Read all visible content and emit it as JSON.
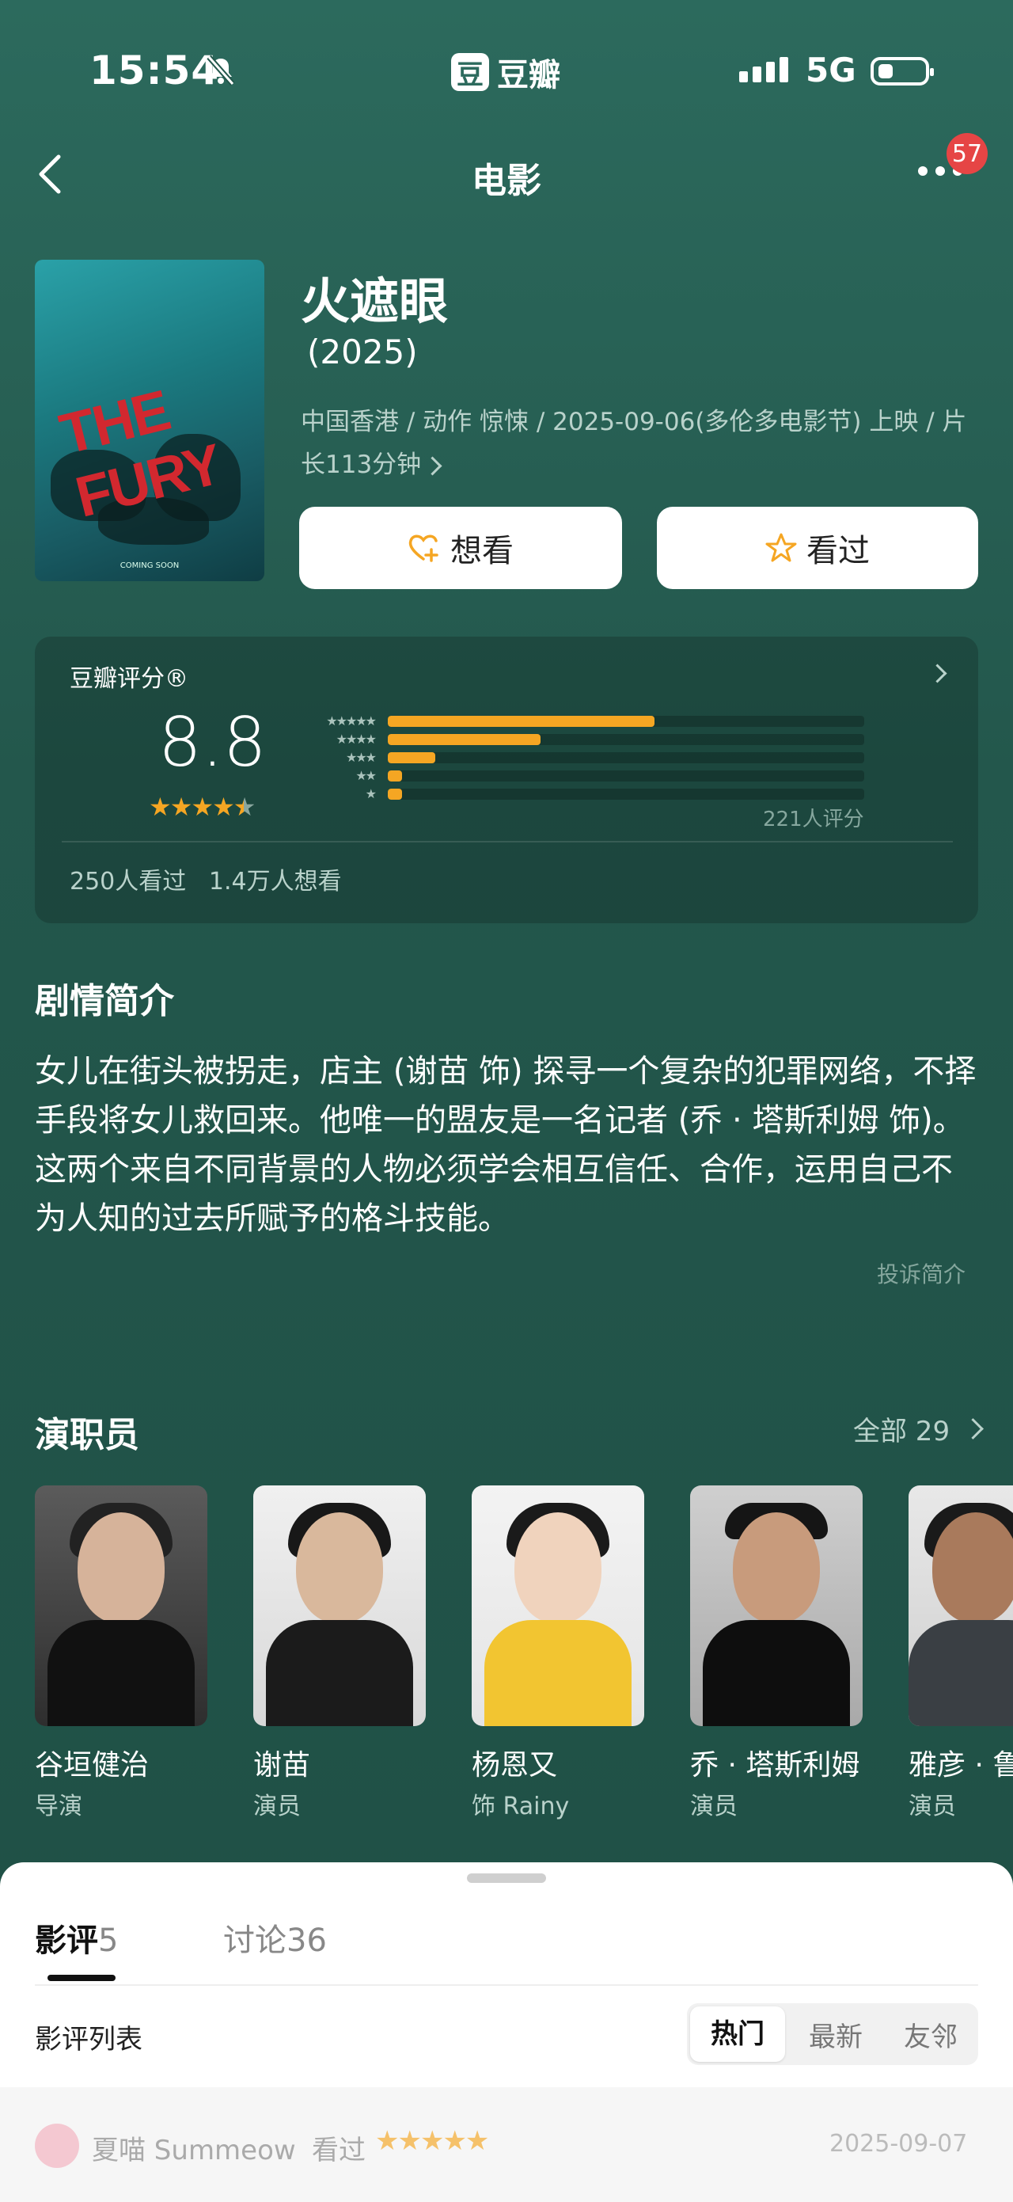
{
  "status_bar": {
    "time": "15:54",
    "app": "豆瓣",
    "app_logo_glyph": "豆",
    "network": "5G"
  },
  "nav": {
    "title": "电影",
    "badge": "57"
  },
  "movie": {
    "title": "火遮眼",
    "year": "(2025)",
    "meta": "中国香港 / 动作 惊悚 / 2025-09-06(多伦多电影节) 上映 / 片长113分钟",
    "poster_title": "THE FURY",
    "poster_foot": "COMING SOON"
  },
  "actions": {
    "want": "想看",
    "seen": "看过"
  },
  "rating": {
    "label": "豆瓣评分®",
    "score": "8.8",
    "stars": 4.5,
    "distribution": [
      {
        "stars": 5,
        "percent": 56
      },
      {
        "stars": 4,
        "percent": 32
      },
      {
        "stars": 3,
        "percent": 10
      },
      {
        "stars": 2,
        "percent": 3
      },
      {
        "stars": 1,
        "percent": 3
      }
    ],
    "count_text": "221人评分",
    "footer": "250人看过   1.4万人想看"
  },
  "synopsis": {
    "title": "剧情简介",
    "text": "女儿在街头被拐走，店主 (谢苗 饰) 探寻一个复杂的犯罪网络，不择手段将女儿救回来。他唯一的盟友是一名记者 (乔 · 塔斯利姆 饰)。这两个来自不同背景的人物必须学会相互信任、合作，运用自己不为人知的过去所赋予的格斗技能。",
    "report": "投诉简介"
  },
  "cast": {
    "title": "演职员",
    "all_label": "全部 29",
    "members": [
      {
        "name": "谷垣健治",
        "role": "导演"
      },
      {
        "name": "谢苗",
        "role": "演员"
      },
      {
        "name": "杨恩又",
        "role": "饰 Rainy"
      },
      {
        "name": "乔 · 塔斯利姆",
        "role": "演员"
      },
      {
        "name": "雅彦 · 鲁",
        "role": "演员"
      }
    ]
  },
  "sheet": {
    "tab_reviews": "影评",
    "tab_reviews_count": "5",
    "tab_discuss": "讨论",
    "tab_discuss_count": "36",
    "list_label": "影评列表",
    "sort_options": [
      "热门",
      "最新",
      "友邻"
    ],
    "review": {
      "user": "夏喵 Summeow",
      "status": "看过",
      "stars": 5,
      "date": "2025-09-07"
    }
  },
  "colors": {
    "accent": "#f5a623",
    "bg": "#23574c",
    "badge": "#e64545"
  }
}
